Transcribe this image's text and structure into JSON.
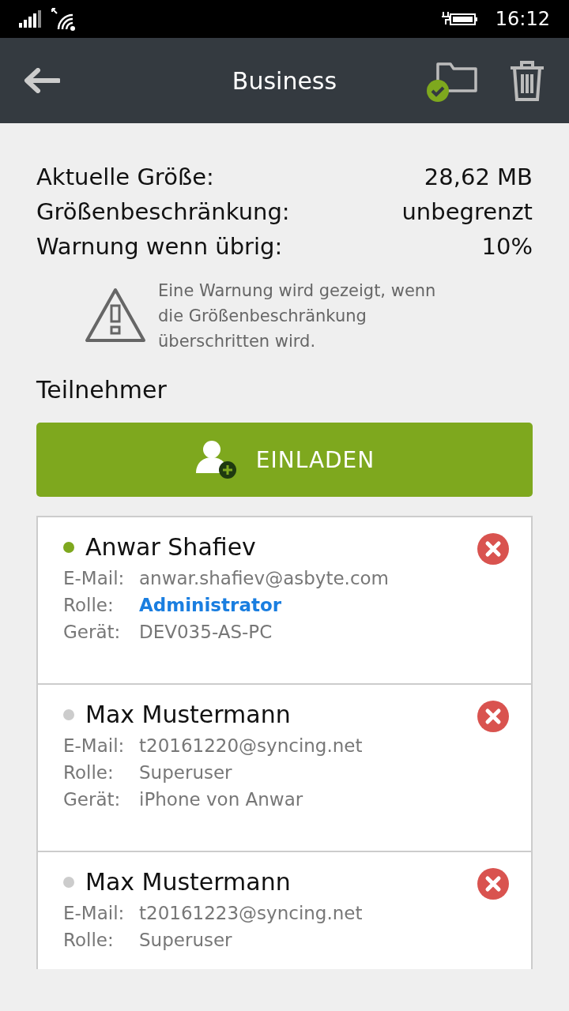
{
  "status_bar": {
    "time": "16:12"
  },
  "header": {
    "title": "Business"
  },
  "stats": [
    {
      "label": "Aktuelle Größe:",
      "value": "28,62 MB"
    },
    {
      "label": "Größenbeschränkung:",
      "value": "unbegrenzt"
    },
    {
      "label": "Warnung wenn übrig:",
      "value": "10%"
    }
  ],
  "warning": {
    "text": "Eine Warnung wird gezeigt, wenn die Größenbeschränkung überschritten wird."
  },
  "participants": {
    "heading": "Teilnehmer",
    "invite_button": "EINLADEN",
    "members": [
      {
        "name": "Anwar Shafiev",
        "online": true,
        "email_label": "E-Mail:",
        "email": "anwar.shafiev@asbyte.com",
        "role_label": "Rolle:",
        "role": "Administrator",
        "role_highlighted": true,
        "device_label": "Gerät:",
        "device": "DEV035-AS-PC"
      },
      {
        "name": "Max Mustermann",
        "online": false,
        "email_label": "E-Mail:",
        "email": "t20161220@syncing.net",
        "role_label": "Rolle:",
        "role": "Superuser",
        "role_highlighted": false,
        "device_label": "Gerät:",
        "device": "iPhone von Anwar"
      },
      {
        "name": "Max Mustermann",
        "online": false,
        "email_label": "E-Mail:",
        "email": "t20161223@syncing.net",
        "role_label": "Rolle:",
        "role": "Superuser",
        "role_highlighted": false
      }
    ]
  }
}
